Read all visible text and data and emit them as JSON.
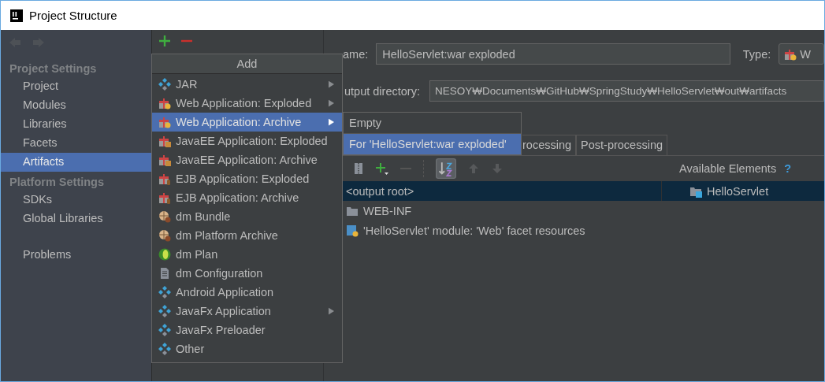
{
  "window": {
    "title": "Project Structure"
  },
  "sidebar": {
    "sections": [
      {
        "title": "Project Settings",
        "items": [
          {
            "label": "Project",
            "selected": false
          },
          {
            "label": "Modules",
            "selected": false
          },
          {
            "label": "Libraries",
            "selected": false
          },
          {
            "label": "Facets",
            "selected": false
          },
          {
            "label": "Artifacts",
            "selected": true
          }
        ]
      },
      {
        "title": "Platform Settings",
        "items": [
          {
            "label": "SDKs",
            "selected": false
          },
          {
            "label": "Global Libraries",
            "selected": false
          }
        ]
      }
    ],
    "footer_items": [
      {
        "label": "Problems",
        "selected": false
      }
    ]
  },
  "add_menu": {
    "title": "Add",
    "items": [
      {
        "label": "JAR",
        "kind": "diamond",
        "submenu": true,
        "selected": false
      },
      {
        "label": "Web Application: Exploded",
        "kind": "gift-web",
        "submenu": true,
        "selected": false
      },
      {
        "label": "Web Application: Archive",
        "kind": "gift-web",
        "submenu": true,
        "selected": true
      },
      {
        "label": "JavaEE Application: Exploded",
        "kind": "gift-ee",
        "submenu": false,
        "selected": false
      },
      {
        "label": "JavaEE Application: Archive",
        "kind": "gift-ee",
        "submenu": false,
        "selected": false
      },
      {
        "label": "EJB Application: Exploded",
        "kind": "gift-ejb",
        "submenu": false,
        "selected": false
      },
      {
        "label": "EJB Application: Archive",
        "kind": "gift-ejb",
        "submenu": false,
        "selected": false
      },
      {
        "label": "dm Bundle",
        "kind": "bundle",
        "submenu": false,
        "selected": false
      },
      {
        "label": "dm Platform Archive",
        "kind": "bundle",
        "submenu": false,
        "selected": false
      },
      {
        "label": "dm Plan",
        "kind": "sphere",
        "submenu": false,
        "selected": false
      },
      {
        "label": "dm Configuration",
        "kind": "document",
        "submenu": false,
        "selected": false
      },
      {
        "label": "Android Application",
        "kind": "diamond",
        "submenu": false,
        "selected": false
      },
      {
        "label": "JavaFx Application",
        "kind": "diamond",
        "submenu": true,
        "selected": false
      },
      {
        "label": "JavaFx Preloader",
        "kind": "diamond",
        "submenu": false,
        "selected": false
      },
      {
        "label": "Other",
        "kind": "diamond",
        "submenu": false,
        "selected": false
      }
    ]
  },
  "submenu": {
    "items": [
      {
        "label": "Empty",
        "selected": false
      },
      {
        "label": "For 'HelloServlet:war exploded'",
        "selected": true
      }
    ]
  },
  "artifact": {
    "name_label": "ame:",
    "name_value": "HelloServlet:war exploded",
    "type_label": "Type:",
    "type_value": "W",
    "output_label": "utput directory:",
    "output_value": "NESOY₩Documents₩GitHub₩SpringStudy₩HelloServlet₩out₩artifacts"
  },
  "tabs": [
    {
      "label": "rocessing",
      "selected": false
    },
    {
      "label": "Post-processing",
      "selected": false
    }
  ],
  "layout_tree": [
    {
      "label": "<output root>",
      "kind": "root",
      "selected": true
    },
    {
      "label": "WEB-INF",
      "kind": "folder",
      "selected": false
    },
    {
      "label": "'HelloServlet' module: 'Web' facet resources",
      "kind": "facet",
      "selected": false
    }
  ],
  "available": {
    "title": "Available Elements",
    "help": "?",
    "items": [
      {
        "label": "HelloServlet",
        "selected": true
      }
    ]
  }
}
